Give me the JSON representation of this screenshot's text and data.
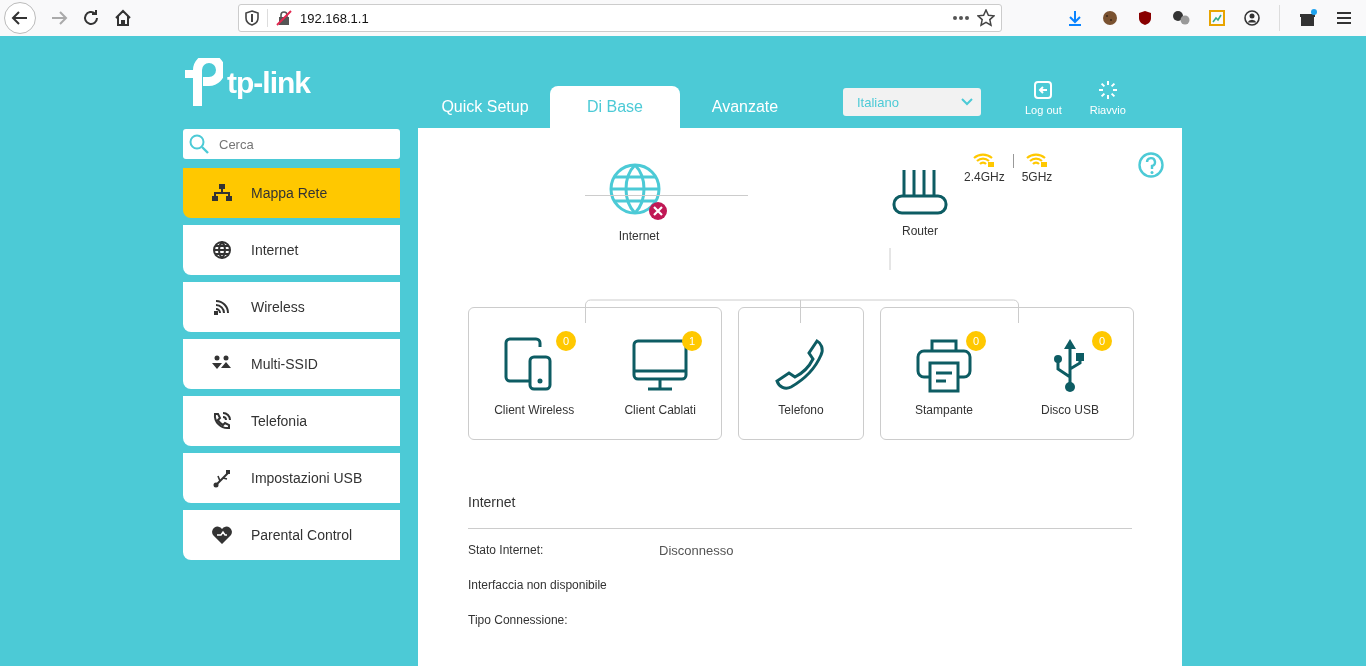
{
  "browser": {
    "url": "192.168.1.1",
    "forward_disabled": true
  },
  "header": {
    "logo": "tp-link",
    "tabs": [
      {
        "label": "Quick Setup",
        "selected": false
      },
      {
        "label": "Di Base",
        "selected": true
      },
      {
        "label": "Avanzate",
        "selected": false
      }
    ],
    "language": {
      "value": "Italiano"
    },
    "actions": [
      {
        "label": "Log out",
        "kind": "logout"
      },
      {
        "label": "Riavvio",
        "kind": "reboot"
      }
    ]
  },
  "sidebar": {
    "search": {
      "placeholder": "Cerca"
    },
    "items": [
      {
        "label": "Mappa Rete",
        "kind": "map",
        "selected": true
      },
      {
        "label": "Internet",
        "kind": "globe",
        "selected": false
      },
      {
        "label": "Wireless",
        "kind": "wifi",
        "selected": false
      },
      {
        "label": "Multi-SSID",
        "kind": "multi",
        "selected": false
      },
      {
        "label": "Telefonia",
        "kind": "phone",
        "selected": false
      },
      {
        "label": "Impostazioni USB",
        "kind": "usb",
        "selected": false
      },
      {
        "label": "Parental Control",
        "kind": "heart",
        "selected": false
      }
    ]
  },
  "network_map": {
    "internet": {
      "label": "Internet",
      "connected": false
    },
    "router": {
      "label": "Router"
    },
    "bands": [
      "2.4GHz",
      "5GHz"
    ],
    "groups": [
      [
        {
          "label": "Client Wireless",
          "kind": "wireless",
          "count": "0"
        },
        {
          "label": "Client Cablati",
          "kind": "wired",
          "count": "1"
        }
      ],
      [
        {
          "label": "Telefono",
          "kind": "phone"
        }
      ],
      [
        {
          "label": "Stampante",
          "kind": "printer",
          "count": "0"
        },
        {
          "label": "Disco USB",
          "kind": "usb",
          "count": "0"
        }
      ]
    ]
  },
  "internet_section": {
    "title": "Internet",
    "rows": [
      {
        "label": "Stato Internet:",
        "value": "Disconnesso"
      },
      {
        "label": "Interfaccia non disponibile"
      },
      {
        "label": "Tipo Connessione:"
      }
    ]
  }
}
